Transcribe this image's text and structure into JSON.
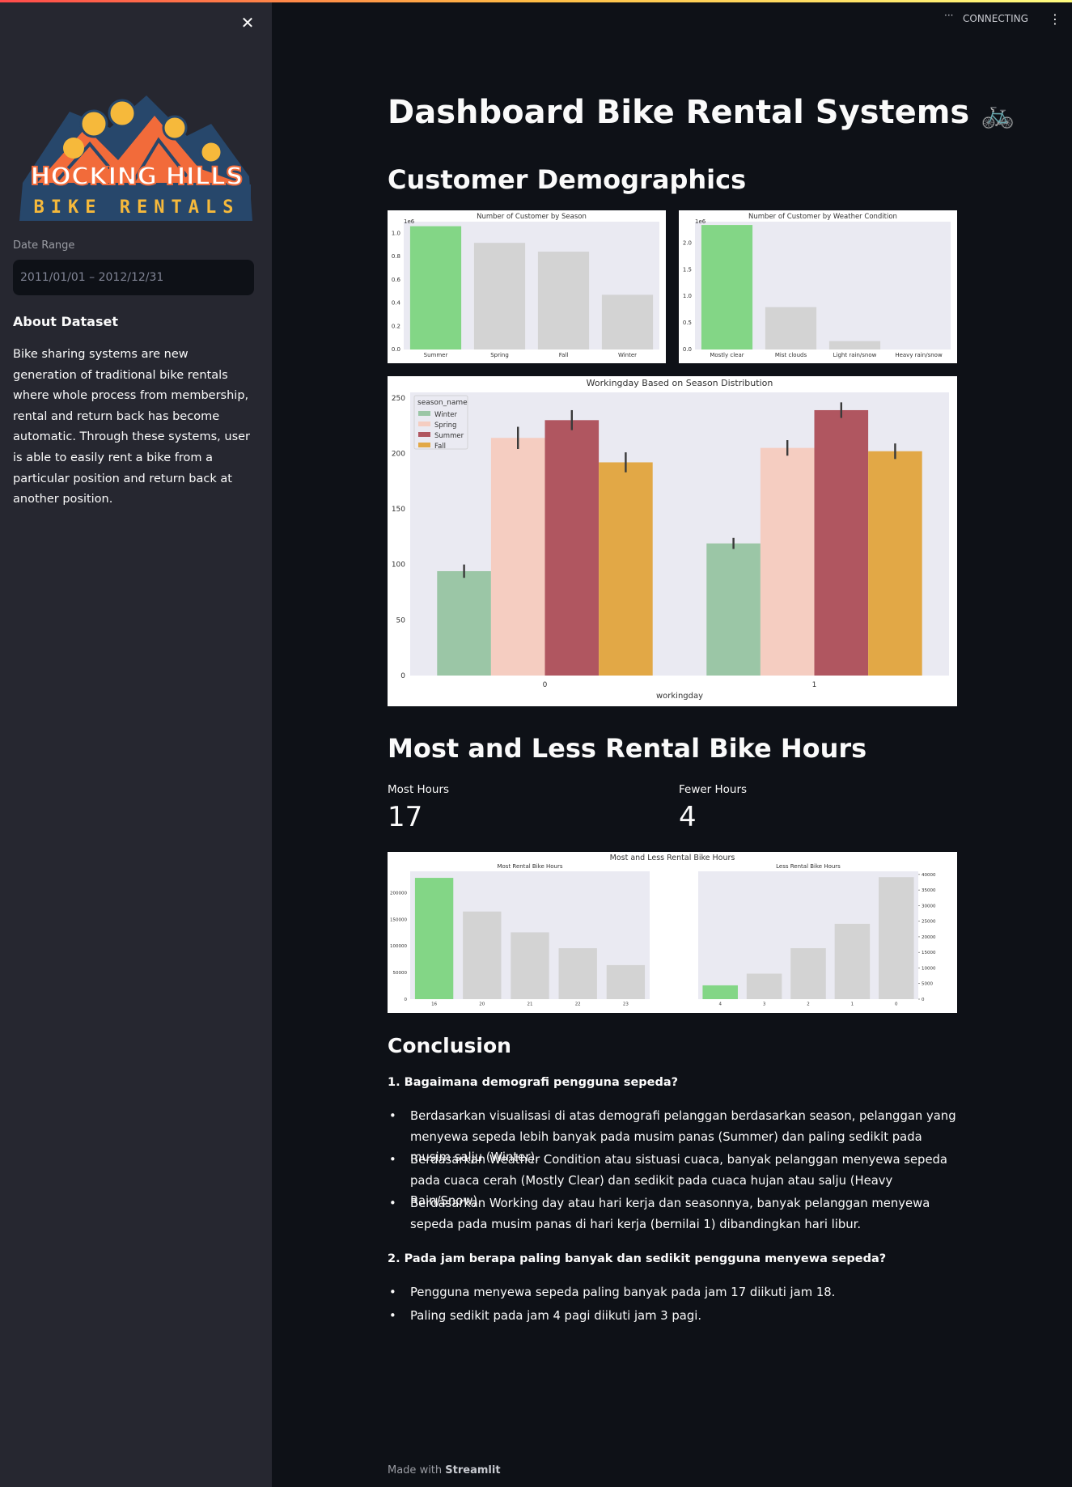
{
  "sidebar": {
    "close_glyph": "✕",
    "logo": {
      "line1": "HOCKING HILLS",
      "line2": "BIKE RENTALS"
    },
    "date_label": "Date Range",
    "date_value": "2011/01/01 – 2012/12/31",
    "about_title": "About Dataset",
    "about_text": "Bike sharing systems are new generation of traditional bike rentals where whole process from membership, rental and return back has become automatic. Through these systems, user is able to easily rent a bike from a particular position and return back at another position."
  },
  "header": {
    "status_dots": "···",
    "status_text": "CONNECTING",
    "menu_glyph": "⋮"
  },
  "main": {
    "title": "Dashboard Bike Rental Systems",
    "title_emoji": "🚲",
    "section_demographics": "Customer Demographics",
    "section_hours": "Most and Less Rental Bike Hours",
    "metric_most_label": "Most Hours",
    "metric_most_value": "17",
    "metric_fewer_label": "Fewer Hours",
    "metric_fewer_value": "4",
    "conclusion_title": "Conclusion",
    "q1": "1. Bagaimana demografi pengguna sepeda?",
    "q1_bullets": [
      "Berdasarkan visualisasi di atas demografi pelanggan berdasarkan season, pelanggan yang menyewa sepeda lebih banyak pada musim panas (Summer) dan paling sedikit pada musim salju (Winter).",
      "Berdasarkan Weather Condition atau sistuasi cuaca, banyak pelanggan menyewa sepeda pada cuaca cerah (Mostly Clear) dan sedikit pada cuaca hujan atau salju (Heavy Rain/Snow).",
      "Berdasarkan Working day atau hari kerja dan seasonnya, banyak pelanggan menyewa sepeda pada musim panas di hari kerja (bernilai 1) dibandingkan hari libur."
    ],
    "q2": "2. Pada jam berapa paling banyak dan sedikit pengguna menyewa sepeda?",
    "q2_bullets": [
      "Pengguna menyewa sepeda paling banyak pada jam 17 diikuti jam 18.",
      "Paling sedikit pada jam 4 pagi diikuti jam 3 pagi."
    ],
    "footer_prefix": "Made with",
    "footer_brand": "Streamlit"
  },
  "colors": {
    "highlight": "#83d686",
    "muted": "#d3d3d3",
    "winter": "#9bc6a6",
    "spring": "#f5cdc1",
    "summer": "#b05660",
    "fall": "#e2a846",
    "plot_bg": "#eaeaf2"
  },
  "chart_data": [
    {
      "type": "bar",
      "title": "Number of Customer by Season",
      "scale_label": "1e6",
      "categories": [
        "Summer",
        "Spring",
        "Fall",
        "Winter"
      ],
      "values": [
        1.061,
        0.918,
        0.842,
        0.471
      ],
      "ylim": [
        0,
        1.1
      ],
      "yticks": [
        "0.0",
        "0.2",
        "0.4",
        "0.6",
        "0.8",
        "1.0"
      ],
      "highlight_index": 0
    },
    {
      "type": "bar",
      "title": "Number of Customer by Weather Condition",
      "scale_label": "1e6",
      "categories": [
        "Mostly clear",
        "Mist clouds",
        "Light rain/snow",
        "Heavy rain/snow"
      ],
      "values": [
        2.338,
        0.796,
        0.158,
        0.0002
      ],
      "ylim": [
        0,
        2.4
      ],
      "yticks": [
        "0.0",
        "0.5",
        "1.0",
        "1.5",
        "2.0"
      ],
      "highlight_index": 0
    },
    {
      "type": "bar",
      "title": "Workingday Based on Season Distribution",
      "xlabel": "workingday",
      "categories": [
        "0",
        "1"
      ],
      "legend_title": "season_name",
      "legend_position": "top-left",
      "series": [
        {
          "name": "Winter",
          "values": [
            94,
            119
          ],
          "err": [
            6,
            5
          ]
        },
        {
          "name": "Spring",
          "values": [
            214,
            205
          ],
          "err": [
            10,
            7
          ]
        },
        {
          "name": "Summer",
          "values": [
            230,
            239
          ],
          "err": [
            9,
            7
          ]
        },
        {
          "name": "Fall",
          "values": [
            192,
            202
          ],
          "err": [
            9,
            7
          ]
        }
      ],
      "ylim": [
        0,
        255
      ],
      "yticks": [
        "0",
        "50",
        "100",
        "150",
        "200",
        "250"
      ]
    },
    {
      "type": "bar",
      "title": "Most and Less Rental Bike Hours",
      "subplots": [
        {
          "title": "Most Rental Bike Hours",
          "categories": [
            "16",
            "20",
            "21",
            "22",
            "23"
          ],
          "values": [
            227748,
            164550,
            125445,
            95612,
            63941
          ],
          "ylim": [
            0,
            240000
          ],
          "yticks": [
            "0",
            "50000",
            "100000",
            "150000",
            "200000"
          ],
          "highlight_index": 0
        },
        {
          "title": "Less Rental Bike Hours",
          "categories": [
            "4",
            "3",
            "2",
            "1",
            "0"
          ],
          "values": [
            4428,
            8174,
            16352,
            24164,
            39130
          ],
          "ylim": [
            0,
            41000
          ],
          "yticks": [
            "0",
            "5000",
            "10000",
            "15000",
            "20000",
            "25000",
            "30000",
            "35000",
            "40000"
          ],
          "highlight_index": 0,
          "axis_side": "right"
        }
      ]
    }
  ]
}
